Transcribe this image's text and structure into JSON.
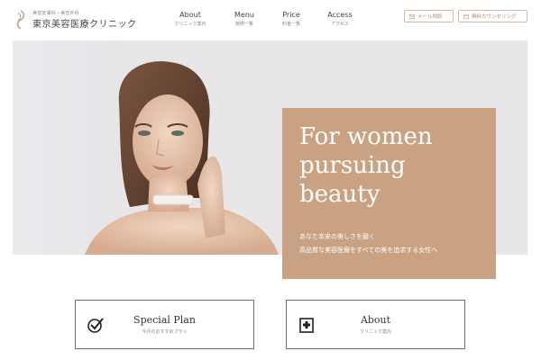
{
  "header": {
    "logo_tagline": "美容皮膚科・美容外科",
    "logo_name": "東京美容医療クリニック",
    "nav": [
      {
        "label": "About",
        "sub": "クリニック案内"
      },
      {
        "label": "Menu",
        "sub": "施術一覧"
      },
      {
        "label": "Price",
        "sub": "料金一覧"
      },
      {
        "label": "Access",
        "sub": "アクセス"
      }
    ],
    "mail_button": "メール相談",
    "counsel_button": "無料カウンセリング"
  },
  "hero": {
    "headline": "For women pursuing beauty",
    "subcopy_line1": "あなた本来の美しさを磨く",
    "subcopy_line2": "高品質な美容医療をすべての美を追求する女性へ"
  },
  "cards": [
    {
      "title": "Special Plan",
      "sub": "今月のおすすめプラン",
      "icon": "check-circle-icon"
    },
    {
      "title": "About",
      "sub": "クリニック案内",
      "icon": "clinic-building-icon"
    }
  ],
  "colors": {
    "accent": "#c9a283",
    "button_border": "#d6b8a3",
    "hero_bg": "#e8e6e9"
  }
}
